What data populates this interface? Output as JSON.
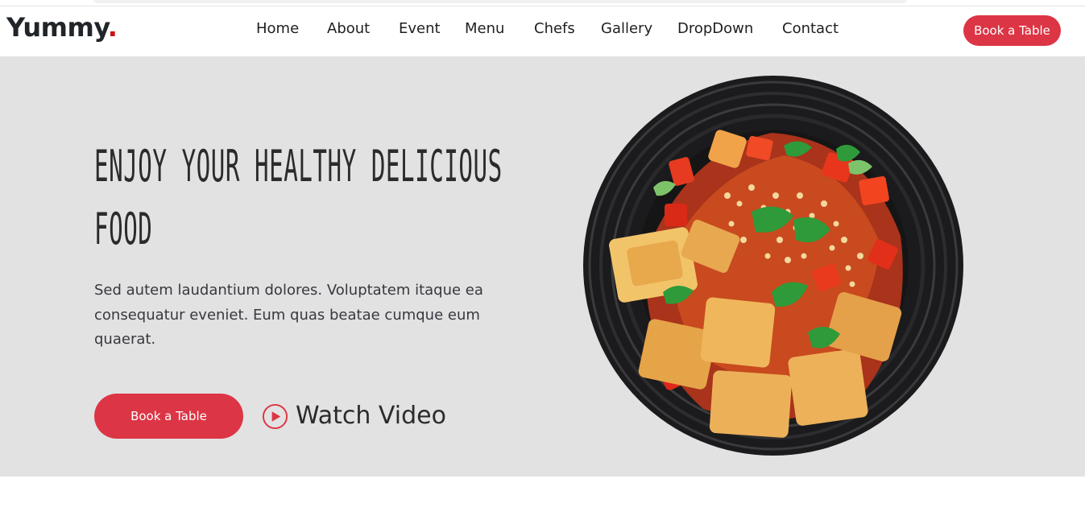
{
  "brand": {
    "name": "Yummy",
    "dot": "."
  },
  "nav": {
    "items": [
      {
        "label": "Home"
      },
      {
        "label": "About"
      },
      {
        "label": "Event"
      },
      {
        "label": "Menu"
      },
      {
        "label": "Chefs"
      },
      {
        "label": "Gallery"
      },
      {
        "label": "DropDown"
      },
      {
        "label": "Contact"
      }
    ],
    "cta_label": "Book a Table"
  },
  "hero": {
    "title_line1": "Enjoy Your Healthy Delicious",
    "title_line2": "Food",
    "description": "Sed autem laudantium dolores. Voluptatem itaque ea consequatur eveniet. Eum quas beatae cumque eum quaerat.",
    "book_label": "Book a Table",
    "watch_label": "Watch Video",
    "play_icon": "play-circle-icon",
    "image_icon": "food-bowl-image"
  },
  "colors": {
    "accent": "#dc3545",
    "hero_bg": "#e2e2e2",
    "text": "#212529"
  }
}
